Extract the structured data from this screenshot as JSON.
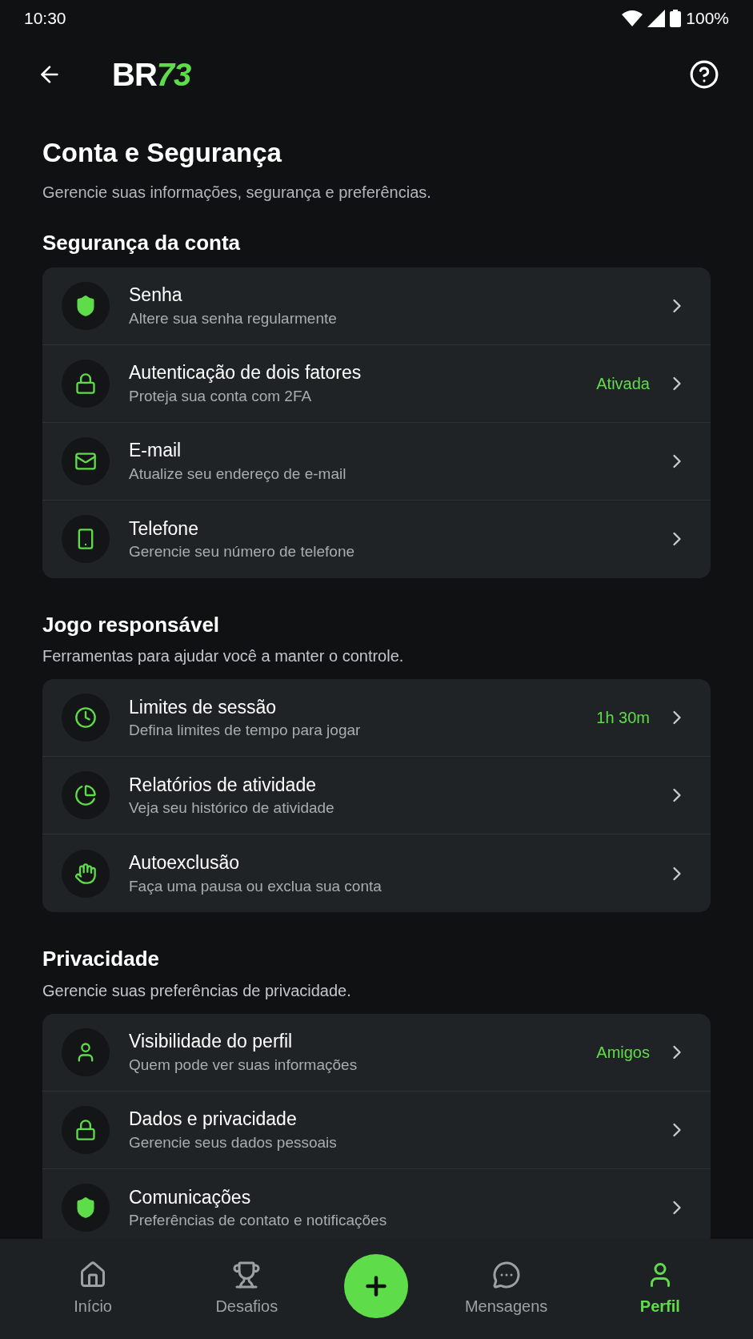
{
  "status_bar": {
    "time": "10:30",
    "battery": "100%"
  },
  "header": {
    "logo": [
      {
        "text": "BR",
        "accent": false
      },
      {
        "text": "73",
        "accent": true
      }
    ]
  },
  "page": {
    "title": "Conta e Segurança",
    "subtitle": "Gerencie suas informações, segurança e preferências."
  },
  "sections": [
    {
      "title": "Segurança da conta",
      "items": [
        {
          "kind": "shield",
          "title": "Senha",
          "subtitle": "Altere sua senha regularmente"
        },
        {
          "kind": "lock",
          "title": "Autenticação de dois fatores",
          "subtitle": "Proteja sua conta com 2FA",
          "value": "Ativada"
        },
        {
          "kind": "mail",
          "title": "E-mail",
          "subtitle": "Atualize seu endereço de e-mail"
        },
        {
          "kind": "phone",
          "title": "Telefone",
          "subtitle": "Gerencie seu número de telefone"
        }
      ]
    },
    {
      "title": "Jogo responsável",
      "subtitle": "Ferramentas para ajudar você a manter o controle.",
      "items": [
        {
          "kind": "clock",
          "title": "Limites de sessão",
          "subtitle": "Defina limites de tempo para jogar",
          "value": "1h 30m"
        },
        {
          "kind": "pie",
          "title": "Relatórios de atividade",
          "subtitle": "Veja seu histórico de atividade"
        },
        {
          "kind": "hand",
          "title": "Autoexclusão",
          "subtitle": "Faça uma pausa ou exclua sua conta"
        }
      ]
    },
    {
      "title": "Privacidade",
      "subtitle": "Gerencie suas preferências de privacidade.",
      "items": [
        {
          "kind": "user",
          "title": "Visibilidade do perfil",
          "subtitle": "Quem pode ver suas informações",
          "value": "Amigos"
        },
        {
          "kind": "lock",
          "title": "Dados e privacidade",
          "subtitle": "Gerencie seus dados pessoais"
        },
        {
          "kind": "shield",
          "title": "Comunicações",
          "subtitle": "Preferências de contato e notificações"
        }
      ]
    }
  ],
  "bottom_nav": [
    {
      "kind": "home",
      "label": "Início",
      "selected": false
    },
    {
      "kind": "trophy",
      "label": "Desafios",
      "selected": false
    },
    {
      "kind": "fab"
    },
    {
      "kind": "chat",
      "label": "Mensagens",
      "selected": false
    },
    {
      "kind": "user",
      "label": "Perfil",
      "selected": true
    }
  ]
}
